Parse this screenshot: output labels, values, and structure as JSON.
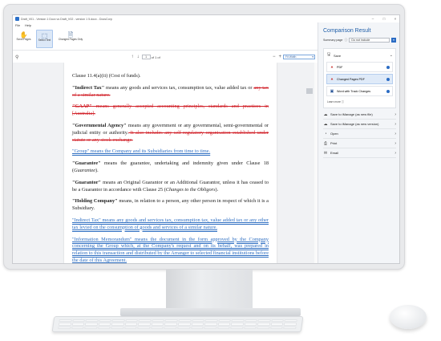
{
  "window": {
    "title": "Draft_V01 - Version 1 Docx vs Draft_V02 - version 1 5.docx - DocsCorp",
    "controls": [
      "–",
      "□",
      "×"
    ]
  },
  "menu": {
    "items": [
      "File",
      "Help"
    ]
  },
  "ribbon": {
    "buttons": [
      {
        "label": "Scroll Pages",
        "icon": "✋"
      },
      {
        "label": "Select Text",
        "icon": "⬚"
      },
      {
        "label": "Changed Pages Only",
        "icon": "🗎"
      }
    ]
  },
  "docbar": {
    "page_current": "1",
    "page_total": "of 1 of",
    "zoom": "Fit Width"
  },
  "document": {
    "lines": {
      "cost_of_funds": "Clause 11.4(a)(ii) (Cost of funds).",
      "indirect_tax_1_term": "\"Indirect Tax\"",
      "indirect_tax_1_text": " means any goods and services tax, consumption tax, value added tax or ",
      "indirect_tax_1_del": "any tax of a similar nature.",
      "gaap_term": "\"GAAP\"",
      "gaap_del": " means generally accepted accounting principles, standards and practices in [Australia].",
      "gov_agency_term": "\"Governmental Agency\"",
      "gov_agency_text": " means any government or any governmental, semi-governmental or judicial entity or authority.",
      "gov_agency_del": " It also includes any self-regulatory organisation established under statute or any stock exchange.",
      "group_ins": "\"Group\" means the Company and its Subsidiaries from time to time.",
      "guarantee_term": "\"Guarantee\"",
      "guarantee_text": " means the guarantee, undertaking and indemnity given under Clause 18 (",
      "guarantee_italic": "Guarantee",
      "guarantee_end": ").",
      "guarantor_term": "\"Guarantor\"",
      "guarantor_text": " means an Original Guarantor or an Additional Guarantor, unless it has ceased to be a Guarantor in accordance with Clause 25 (",
      "guarantor_italic": "Changes to the Obligors",
      "guarantor_end": ").",
      "holding_term": "\"Holding Company\"",
      "holding_text": " means, in relation to a person, any other person in respect of which it is a Subsidiary.",
      "indirect_tax_2_ins": "\"Indirect Tax\" means any goods and services tax, consumption tax, value added tax or any other tax levied on the consumption of goods and services of a similar nature.",
      "info_memo_ins": "\"Information Memorandum\" means the document in the form approved by the Company concerning the Group which, at the Company's request and on its behalf, was prepared in relation to this transaction and distributed by the Arranger to selected financial institutions before the date of this Agreement."
    }
  },
  "panel": {
    "title": "Comparison Result",
    "summary_label": "Summary page",
    "summary_value": "Do not include",
    "save_label": "Save",
    "save_options": [
      {
        "label": "PDF",
        "icon": "pdf-icon"
      },
      {
        "label": "Changed Pages PDF",
        "icon": "pdf-icon"
      },
      {
        "label": "Word with Track Changes",
        "icon": "word-icon"
      }
    ],
    "learn_more": "Learn more",
    "actions": [
      {
        "label": "Save to iManage (as new file)",
        "icon": "cloud-icon"
      },
      {
        "label": "Save to iManage (as new version)",
        "icon": "cloud-icon"
      },
      {
        "label": "Open",
        "icon": "open-icon"
      },
      {
        "label": "Print",
        "icon": "print-icon"
      },
      {
        "label": "Email",
        "icon": "email-icon"
      }
    ]
  },
  "colors": {
    "accent": "#2b6cc4",
    "deleted": "#d2242c",
    "inserted": "#2f6fc2"
  }
}
